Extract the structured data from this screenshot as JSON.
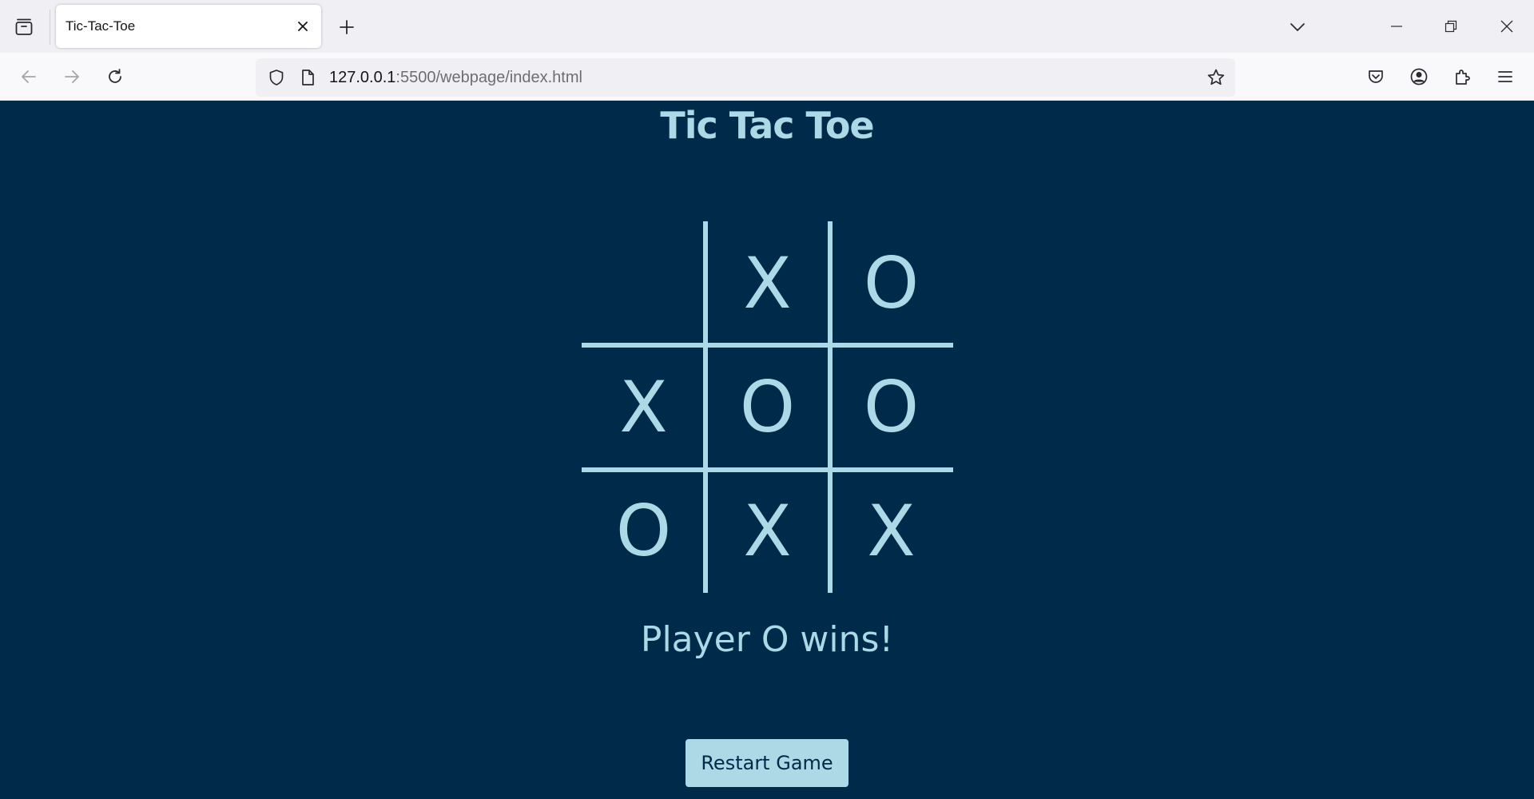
{
  "browser": {
    "tab_title": "Tic-Tac-Toe",
    "url_host": "127.0.0.1",
    "url_path": ":5500/webpage/index.html",
    "icons": {
      "tab_list": "tab-list-icon",
      "close_tab": "close-icon",
      "new_tab": "plus-icon",
      "list_all_tabs": "chevron-down-icon",
      "minimize": "minimize-icon",
      "restore": "restore-icon",
      "close_window": "close-icon",
      "back": "arrow-left-icon",
      "forward": "arrow-right-icon",
      "reload": "reload-icon",
      "tracking_protection": "shield-icon",
      "page_info": "page-icon",
      "bookmark": "star-icon",
      "pocket": "pocket-icon",
      "account": "account-icon",
      "extensions": "puzzle-icon",
      "menu": "hamburger-menu-icon"
    }
  },
  "game": {
    "title": "Tic Tac Toe",
    "board": [
      [
        "",
        "X",
        "O"
      ],
      [
        "X",
        "O",
        "O"
      ],
      [
        "O",
        "X",
        "X"
      ]
    ],
    "status": "Player O wins!",
    "restart_label": "Restart Game"
  },
  "colors": {
    "background": "#002a4a",
    "accent": "#add8e6",
    "button_text": "#002a4a"
  }
}
